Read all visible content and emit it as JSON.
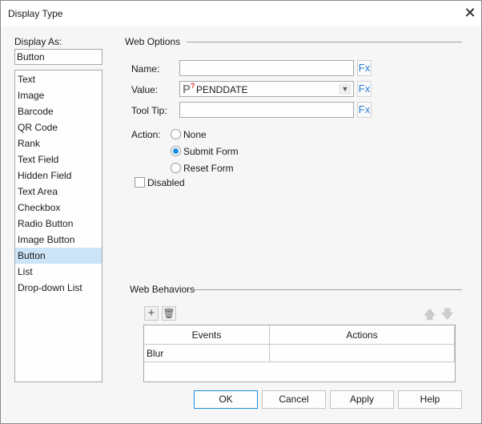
{
  "window": {
    "title": "Display Type"
  },
  "display_as": {
    "label": "Display As:",
    "value": "Button",
    "items": [
      "Text",
      "Image",
      "Barcode",
      "QR Code",
      "Rank",
      "Text Field",
      "Hidden Field",
      "Text Area",
      "Checkbox",
      "Radio Button",
      "Image Button",
      "Button",
      "List",
      "Drop-down List"
    ],
    "selected": "Button"
  },
  "web_options": {
    "heading": "Web Options",
    "name_label": "Name:",
    "name_value": "",
    "value_label": "Value:",
    "value_value": "PENDDATE",
    "tooltip_label": "Tool Tip:",
    "tooltip_value": "",
    "fx": "Fx",
    "action_label": "Action:",
    "actions": [
      "None",
      "Submit Form",
      "Reset Form"
    ],
    "selected_action": "Submit Form",
    "disabled_label": "Disabled",
    "disabled_checked": false
  },
  "web_behaviors": {
    "heading": "Web Behaviors",
    "columns": [
      "Events",
      "Actions"
    ],
    "rows": [
      [
        "Blur",
        ""
      ]
    ]
  },
  "buttons": {
    "ok": "OK",
    "cancel": "Cancel",
    "apply": "Apply",
    "help": "Help"
  },
  "colors": {
    "accent": "#1a8ce0",
    "selection": "#cce4f7"
  }
}
